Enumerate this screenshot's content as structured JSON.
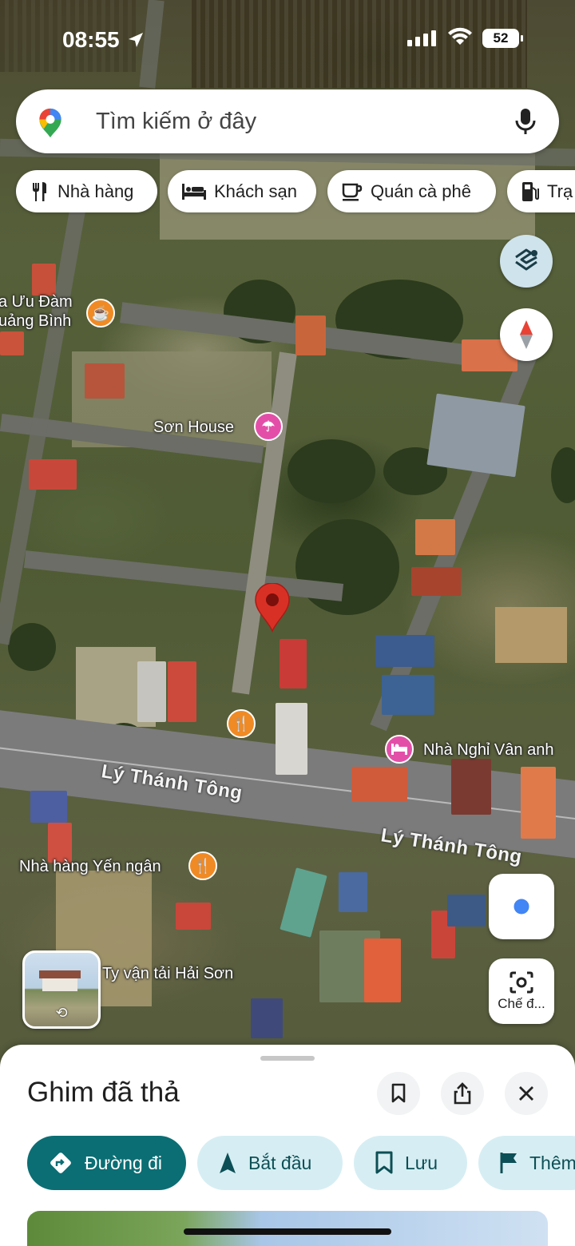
{
  "status_bar": {
    "time": "08:55",
    "battery": "52",
    "location_icon": "location-arrow-icon",
    "signal_icon": "cellular-signal-icon",
    "wifi_icon": "wifi-icon"
  },
  "search": {
    "placeholder": "Tìm kiếm ở đây",
    "logo_icon": "google-maps-pin-icon",
    "mic_icon": "microphone-icon"
  },
  "categories": [
    {
      "label": "Nhà hàng",
      "icon": "fork-knife-icon"
    },
    {
      "label": "Khách sạn",
      "icon": "bed-icon"
    },
    {
      "label": "Quán cà phê",
      "icon": "coffee-cup-icon"
    },
    {
      "label": "Trạ",
      "icon": "gas-station-icon"
    }
  ],
  "map": {
    "poi": [
      {
        "label_line1": "a Ưu Đàm",
        "label_line2": "uảng Bình",
        "icon": "coffee-cup-icon",
        "color": "#f08a24"
      },
      {
        "label": "Sơn House",
        "icon": "umbrella-beach-icon",
        "color": "#e34fa8"
      },
      {
        "label": "Nhà Nghỉ Vân anh",
        "icon": "bed-icon",
        "color": "#e34fa8"
      },
      {
        "label": "Nhà hàng Yến ngân",
        "icon": "fork-knife-icon",
        "color": "#f08a24"
      },
      {
        "label": "Ty vận tải Hải Sơn"
      },
      {
        "icon": "fork-knife-icon",
        "color": "#f08a24"
      }
    ],
    "roads": [
      "Lý Thánh Tông",
      "Lý Thánh Tông"
    ],
    "dropped_pin_color": "#d93025"
  },
  "controls": {
    "layers_icon": "layers-icon",
    "compass_icon": "compass-icon",
    "my_location_icon": "my-location-icon",
    "lens_icon": "camera-lens-icon",
    "lens_label": "Chế đ..."
  },
  "sheet": {
    "title": "Ghim đã thả",
    "save_icon": "bookmark-icon",
    "share_icon": "share-icon",
    "close_icon": "close-icon",
    "actions": [
      {
        "label": "Đường đi",
        "icon": "directions-icon"
      },
      {
        "label": "Bắt đầu",
        "icon": "navigation-arrow-icon"
      },
      {
        "label": "Lưu",
        "icon": "bookmark-icon"
      },
      {
        "label": "Thêm",
        "icon": "flag-icon"
      }
    ],
    "accent_color": "#0b6e74"
  }
}
